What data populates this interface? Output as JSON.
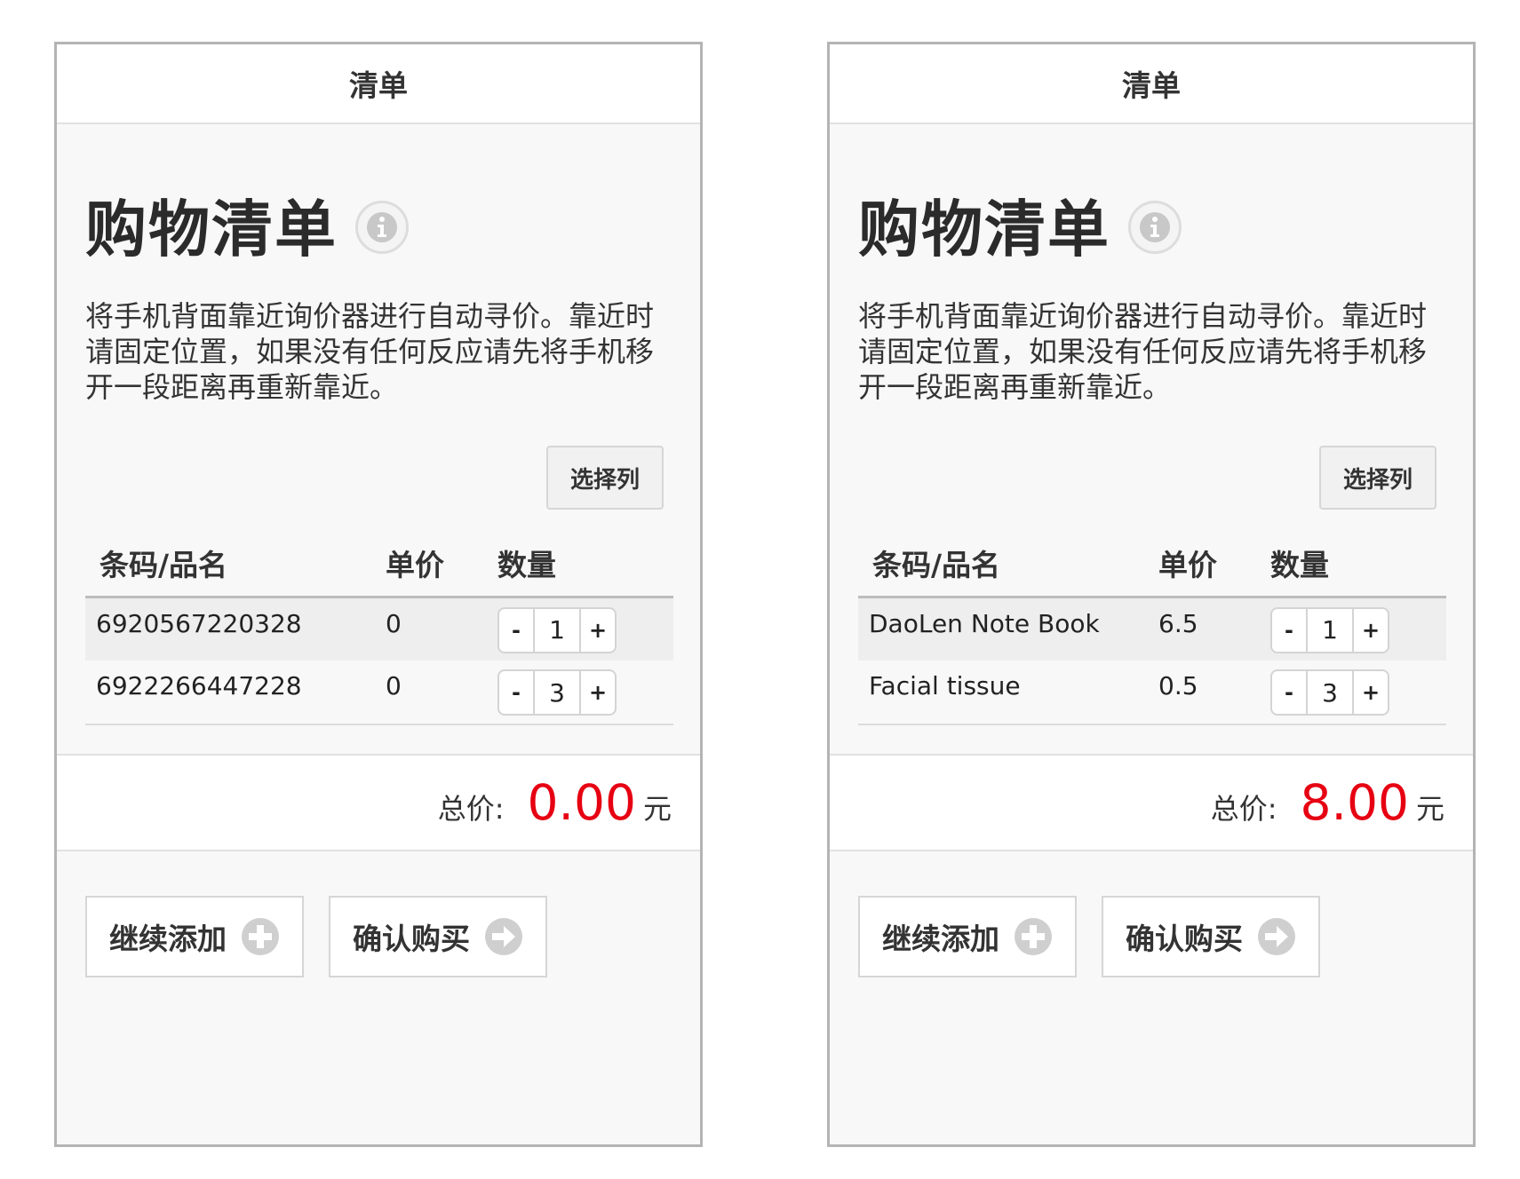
{
  "screens": [
    {
      "topbar_title": "清单",
      "heading": "购物清单",
      "description": "将手机背面靠近询价器进行自动寻价。靠近时请固定位置，如果没有任何反应请先将手机移开一段距离再重新靠近。",
      "select_columns_label": "选择列",
      "columns": [
        "条码/品名",
        "单价",
        "数量"
      ],
      "items": [
        {
          "name": "6920567220328",
          "price": "0",
          "qty": "1"
        },
        {
          "name": "6922266447228",
          "price": "0",
          "qty": "3"
        }
      ],
      "total_label": "总价:",
      "total_value": "0.00",
      "total_unit": "元",
      "continue_label": "继续添加",
      "confirm_label": "确认购买"
    },
    {
      "topbar_title": "清单",
      "heading": "购物清单",
      "description": "将手机背面靠近询价器进行自动寻价。靠近时请固定位置，如果没有任何反应请先将手机移开一段距离再重新靠近。",
      "select_columns_label": "选择列",
      "columns": [
        "条码/品名",
        "单价",
        "数量"
      ],
      "items": [
        {
          "name": "DaoLen Note Book",
          "price": "6.5",
          "qty": "1"
        },
        {
          "name": "Facial tissue",
          "price": "0.5",
          "qty": "3"
        }
      ],
      "total_label": "总价:",
      "total_value": "8.00",
      "total_unit": "元",
      "continue_label": "继续添加",
      "confirm_label": "确认购买"
    }
  ],
  "stepper": {
    "minus": "-",
    "plus": "+"
  },
  "icons": {
    "info": "info-icon",
    "add": "plus-circle-icon",
    "confirm": "arrow-right-circle-icon"
  },
  "colors": {
    "total_value": "#e60012",
    "icon_gray": "#cfcfcf"
  }
}
